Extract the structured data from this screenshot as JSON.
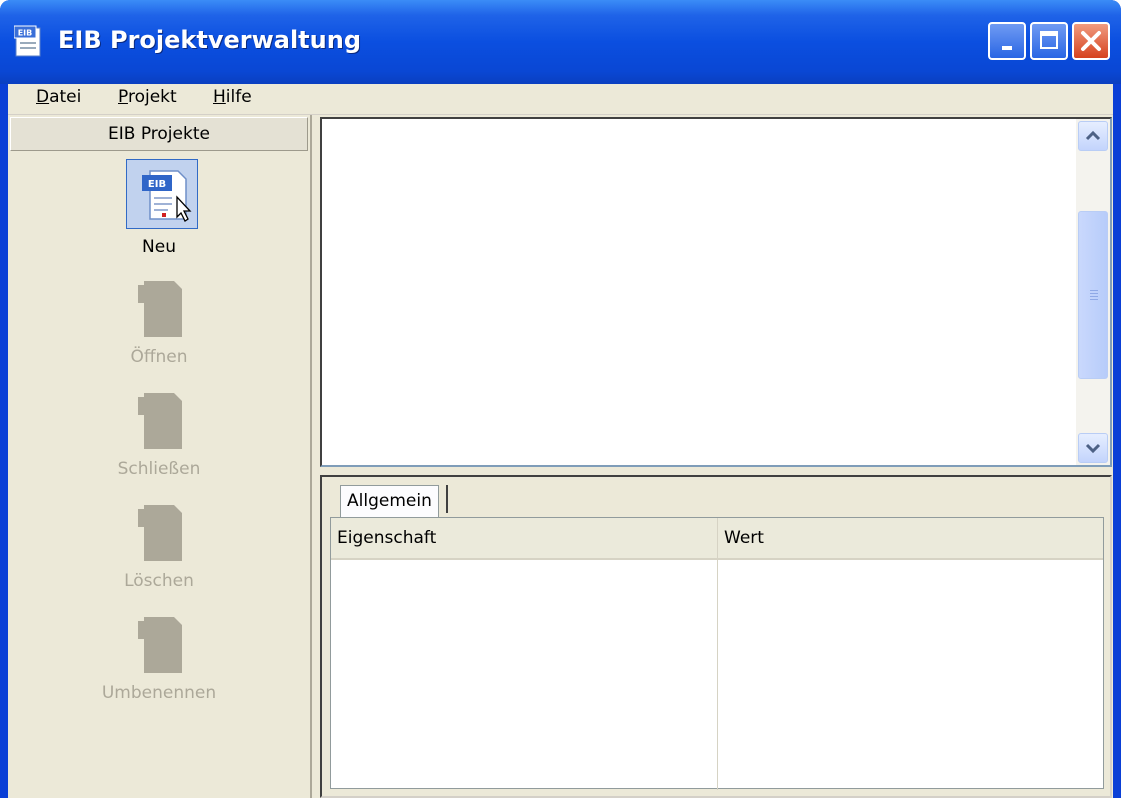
{
  "window": {
    "title": "EIB Projektverwaltung",
    "app_icon_text": "EIB"
  },
  "menu": [
    {
      "label": "Datei",
      "accel": "D",
      "rest": "atei"
    },
    {
      "label": "Projekt",
      "accel": "P",
      "rest": "rojekt"
    },
    {
      "label": "Hilfe",
      "accel": "H",
      "rest": "ilfe"
    }
  ],
  "sidebar": {
    "header": "EIB Projekte",
    "tools": [
      {
        "label": "Neu",
        "enabled": true,
        "icon": "new-project-icon"
      },
      {
        "label": "Öffnen",
        "enabled": false,
        "icon": "open-project-icon"
      },
      {
        "label": "Schließen",
        "enabled": false,
        "icon": "close-project-icon"
      },
      {
        "label": "Löschen",
        "enabled": false,
        "icon": "delete-project-icon"
      },
      {
        "label": "Umbenennen",
        "enabled": false,
        "icon": "rename-project-icon"
      }
    ]
  },
  "properties": {
    "tab": "Allgemein",
    "columns": [
      "Eigenschaft",
      "Wert"
    ]
  },
  "colors": {
    "title_blue": "#0b4fe0",
    "face": "#ece9d8",
    "disabled_text": "#aca899"
  }
}
